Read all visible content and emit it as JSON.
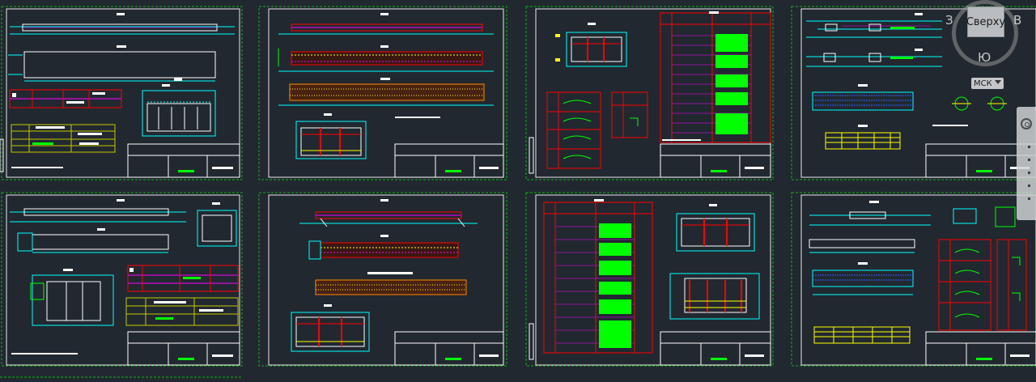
{
  "viewcube": {
    "top_face": "Сверху",
    "west": "З",
    "east": "В",
    "south": "Ю"
  },
  "ucs_menu": {
    "label": "МСК"
  },
  "colors": {
    "background": "#212830",
    "sheet_border": "#ffffff",
    "layout_frame": "#0fb30f",
    "dimension": "#00ffff",
    "rebar": "#ff0000",
    "hatch": "#ffff00",
    "text_fill": "#00ff00",
    "accent": "#ff00ff"
  },
  "sheets": [
    {
      "id": "sheet-1"
    },
    {
      "id": "sheet-2"
    },
    {
      "id": "sheet-3"
    },
    {
      "id": "sheet-4"
    },
    {
      "id": "sheet-5"
    },
    {
      "id": "sheet-6"
    },
    {
      "id": "sheet-7"
    },
    {
      "id": "sheet-8"
    }
  ],
  "navigation_bar": {
    "icon": "steering-wheel-icon"
  }
}
